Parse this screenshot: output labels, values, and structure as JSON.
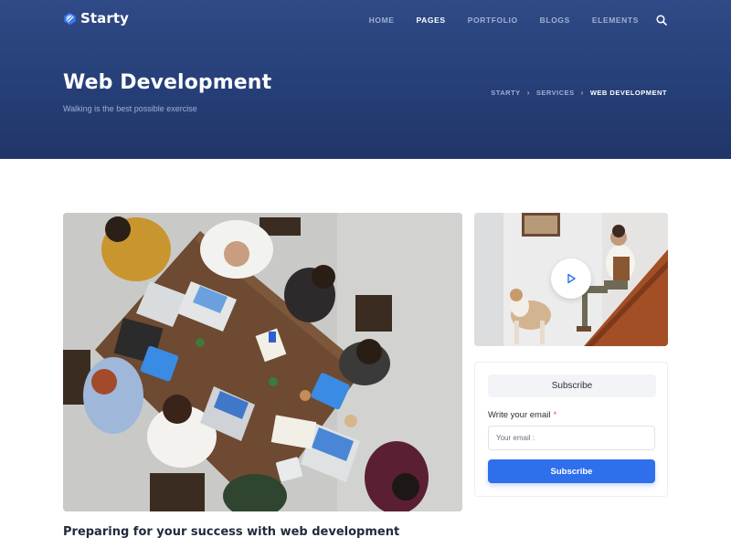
{
  "brand": {
    "name": "Starty",
    "accent": "#2f6fec"
  },
  "nav": {
    "items": [
      {
        "label": "HOME",
        "active": false
      },
      {
        "label": "PAGES",
        "active": true
      },
      {
        "label": "PORTFOLIO",
        "active": false
      },
      {
        "label": "BLOGS",
        "active": false
      },
      {
        "label": "ELEMENTS",
        "active": false
      }
    ],
    "search_icon": "search-icon"
  },
  "hero": {
    "title": "Web Development",
    "subtitle": "Walking is the best possible exercise",
    "breadcrumb": [
      "STARTY",
      "SERVICES",
      "WEB DEVELOPMENT"
    ],
    "breadcrumb_separator": "›"
  },
  "video": {
    "play_icon": "play-icon"
  },
  "subscribe": {
    "heading": "Subscribe",
    "email_label": "Write your email",
    "required_mark": "*",
    "email_placeholder": "Your email :",
    "button_label": "Subscribe"
  },
  "main": {
    "heading": "Preparing for your success with web development"
  }
}
